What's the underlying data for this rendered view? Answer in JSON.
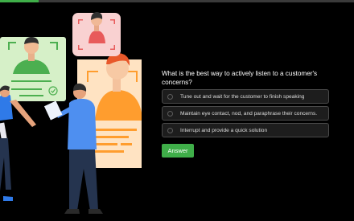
{
  "progress": {
    "fraction": 0.11,
    "color": "#3fae49"
  },
  "question": {
    "text": "What is the best way to actively listen to a customer's concerns?"
  },
  "options": [
    {
      "label": "Tune out and wait for the customer to finish speaking"
    },
    {
      "label": "Maintain eye contact, nod, and paraphrase their concerns."
    },
    {
      "label": "Interrupt and provide a quick solution"
    }
  ],
  "answer_button": {
    "label": "Answer",
    "color": "#3fae49"
  },
  "illustration": {
    "icon": "video-call-people-illustration"
  }
}
